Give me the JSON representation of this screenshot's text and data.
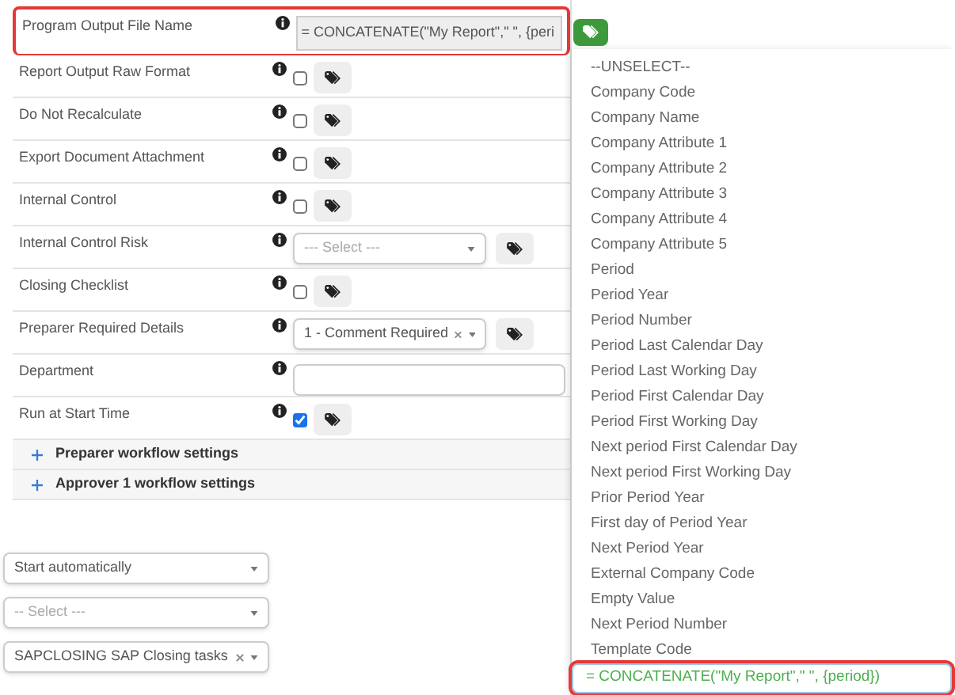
{
  "fields": [
    {
      "kind": "text",
      "label": "Program Output File Name",
      "value": "= CONCATENATE(\"My Report\",\" \", {peri",
      "highlighted": true
    },
    {
      "kind": "checkbox",
      "label": "Report Output Raw Format",
      "checked": false
    },
    {
      "kind": "checkbox",
      "label": "Do Not Recalculate",
      "checked": false
    },
    {
      "kind": "checkbox",
      "label": "Export Document Attachment",
      "checked": false
    },
    {
      "kind": "checkbox",
      "label": "Internal Control",
      "checked": false
    },
    {
      "kind": "select",
      "label": "Internal Control Risk",
      "placeholder": "--- Select ---",
      "clearable": false
    },
    {
      "kind": "checkbox",
      "label": "Closing Checklist",
      "checked": false
    },
    {
      "kind": "select",
      "label": "Preparer Required Details",
      "value": "1 - Comment Required",
      "clearable": true
    },
    {
      "kind": "input",
      "label": "Department"
    },
    {
      "kind": "checkbox",
      "label": "Run at Start Time",
      "checked": true
    }
  ],
  "sections": [
    {
      "label": "Preparer workflow settings",
      "expanded": false
    },
    {
      "label": "Approver 1 workflow settings",
      "expanded": false
    }
  ],
  "lower_selects": [
    {
      "value": "Start automatically",
      "clearable": false
    },
    {
      "placeholder": "-- Select ---"
    },
    {
      "value": "SAPCLOSING SAP Closing tasks",
      "clearable": true
    }
  ],
  "tag_menu": {
    "options": [
      "--UNSELECT--",
      "Company Code",
      "Company Name",
      "Company Attribute 1",
      "Company Attribute 2",
      "Company Attribute 3",
      "Company Attribute 4",
      "Company Attribute 5",
      "Period",
      "Period Year",
      "Period Number",
      "Period Last Calendar Day",
      "Period Last Working Day",
      "Period First Calendar Day",
      "Period First Working Day",
      "Next period First Calendar Day",
      "Next period First Working Day",
      "Prior Period Year",
      "First day of Period Year",
      "Next Period Year",
      "External Company Code",
      "Empty Value",
      "Next Period Number",
      "Template Code"
    ],
    "formula": "= CONCATENATE(\"My Report\",\" \", {period})",
    "highlighted": true
  }
}
